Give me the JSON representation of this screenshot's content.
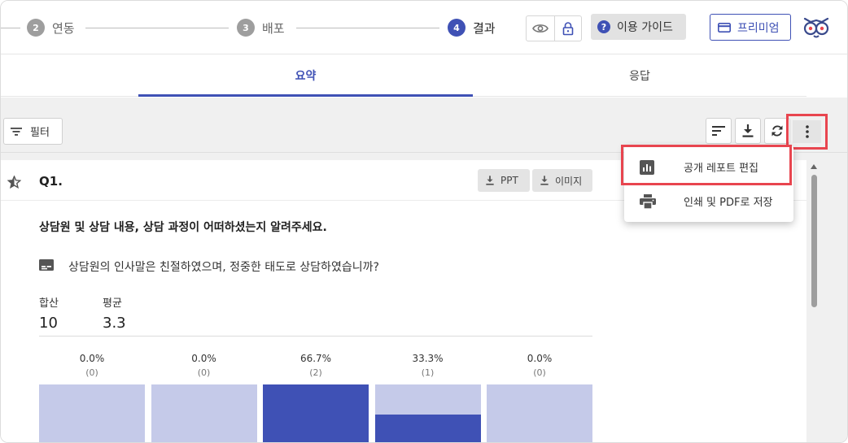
{
  "steps": [
    {
      "num": "2",
      "label": "연동",
      "active": false
    },
    {
      "num": "3",
      "label": "배포",
      "active": false
    },
    {
      "num": "4",
      "label": "결과",
      "active": true
    }
  ],
  "header": {
    "guide_label": "이용 가이드",
    "premium_label": "프리미엄"
  },
  "tabs": [
    {
      "label": "요약",
      "active": true
    },
    {
      "label": "응답",
      "active": false
    }
  ],
  "toolbar": {
    "filter_label": "필터"
  },
  "menu": {
    "items": [
      {
        "label": "공개 레포트 편집",
        "icon": "bar-chart-icon"
      },
      {
        "label": "인쇄 및 PDF로 저장",
        "icon": "printer-icon"
      }
    ]
  },
  "question": {
    "number": "Q1.",
    "ppt_label": "PPT",
    "image_label": "이미지",
    "title": "상담원 및 상담 내용, 상담 과정이 어떠하셨는지 알려주세요.",
    "sub_question": "상담원의 인사말은 친절하였으며, 정중한 태도로 상담하였습니까?",
    "stats": {
      "sum_label": "합산",
      "sum_value": "10",
      "avg_label": "평균",
      "avg_value": "3.3"
    }
  },
  "chart_data": {
    "type": "bar",
    "values": [
      0.0,
      0.0,
      66.7,
      33.3,
      0.0
    ],
    "percent_labels": [
      "0.0%",
      "0.0%",
      "66.7%",
      "33.3%",
      "0.0%"
    ],
    "count_labels": [
      "(0)",
      "(0)",
      "(2)",
      "(1)",
      "(0)"
    ],
    "ylim": [
      0,
      100
    ],
    "colors": {
      "fill": "#3f51b5",
      "track": "#c5cae9"
    }
  },
  "colors": {
    "accent": "#3f51b5",
    "highlight": "#e8454f"
  }
}
